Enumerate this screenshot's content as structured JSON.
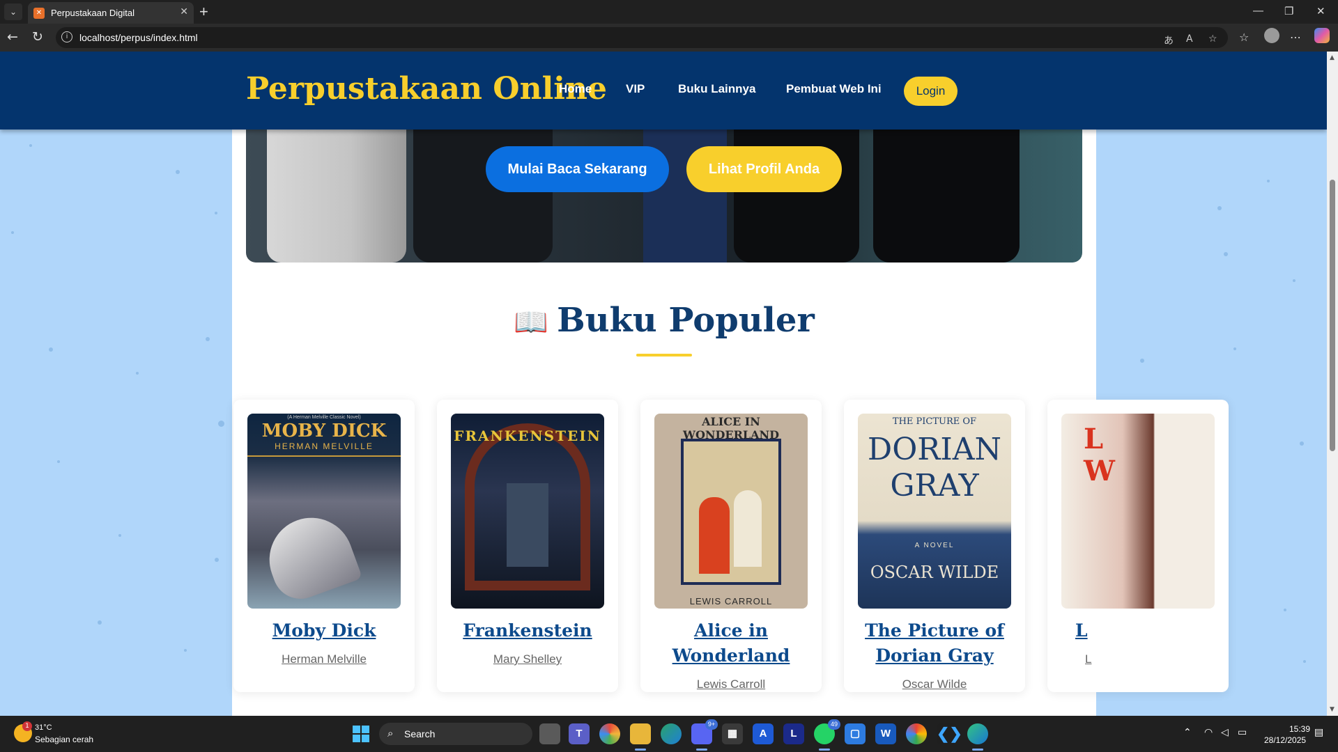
{
  "browser": {
    "tab_title": "Perpustakaan Digital",
    "url": "localhost/perpus/index.html"
  },
  "site": {
    "brand": "Perpustakaan Online",
    "nav": [
      "Home",
      "VIP",
      "Buku Lainnya",
      "Pembuat Web Ini"
    ],
    "login_label": "Login",
    "colors": {
      "header": "#04346d",
      "accent": "#f8cf2c",
      "primary_button": "#0b6fe0"
    }
  },
  "hero": {
    "primary_cta": "Mulai Baca Sekarang",
    "secondary_cta": "Lihat Profil Anda"
  },
  "popular": {
    "icon": "📖",
    "heading": "Buku Populer",
    "books": [
      {
        "title": "Moby Dick",
        "author": "Herman Melville",
        "cover_text": "MOBY DICK",
        "cover_sub": "HERMAN MELVILLE",
        "cover_top": "(A Herman Melville Classic Novel)"
      },
      {
        "title": "Frankenstein",
        "author": "Mary Shelley",
        "cover_text": "FRANKENSTEIN"
      },
      {
        "title": "Alice in Wonderland",
        "author": "Lewis Carroll",
        "cover_text": "ALICE IN WONDERLAND",
        "cover_sub": "LEWIS CARROLL"
      },
      {
        "title": "The Picture of Dorian Gray",
        "author": "Oscar Wilde",
        "cover_top": "THE PICTURE OF",
        "cover_text": "DORIAN GRAY",
        "cover_mid": "A NOVEL",
        "cover_sub": "OSCAR WILDE"
      },
      {
        "title": "L",
        "author": "L",
        "cover_text": "L W"
      }
    ]
  },
  "taskbar": {
    "weather_temp": "31°C",
    "weather_desc": "Sebagian cerah",
    "weather_badge": "1",
    "search_label": "Search",
    "discord_badge": "9+",
    "whatsapp_badge": "49",
    "clock_time": "15:39",
    "clock_date": "28/12/2025"
  }
}
